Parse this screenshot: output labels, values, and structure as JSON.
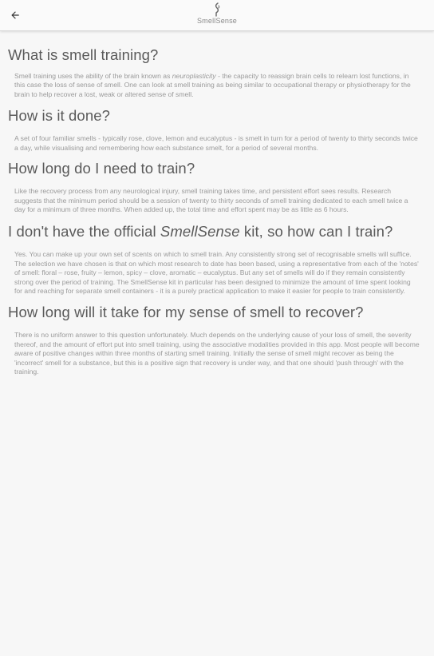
{
  "app": {
    "name": "SmellSense",
    "back_icon": "arrow-back-icon",
    "logo_icon": "smellsense-logo-icon",
    "colors": {
      "background": "#f7f7f7",
      "appbar": "#fafafa",
      "heading": "#5a5a5a",
      "body": "#9a9a9a"
    }
  },
  "sections": [
    {
      "title": "What is smell training?",
      "body_before": "Smell training uses the ability of the brain known as ",
      "body_em": "neuroplasticity",
      "body_after": " - the capacity to reassign brain cells to relearn lost functions, in this case the loss of sense of smell. One can look at smell training as being similar to occupational therapy or physiotherapy for the brain to help recover a lost, weak or altered sense of smell."
    },
    {
      "title": "How is it done?",
      "body": "A set of four familiar smells - typically rose, clove, lemon and eucalyptus - is smelt in turn for a period of twenty to thirty seconds twice a day, while visualising and remembering how each substance smelt, for a period of several months."
    },
    {
      "title": "How long do I need to train?",
      "body": "Like the recovery process from any neurological injury, smell training takes time, and persistent effort sees results. Research suggests that the minimum period should be a session of twenty to thirty seconds of smell training dedicated to each smell twice a day for a minimum of three months. When added up, the total time and effort spent may be as little as 6 hours."
    },
    {
      "title_before": "I don't have the official ",
      "title_em": "SmellSense",
      "title_after": " kit, so how can I train?",
      "body": "Yes. You can make up your own set of scents on which to smell train. Any consistently strong set of recognisable smells will suffice. The selection we have chosen is that on which most research to date has been based, using a representative from each of the 'notes' of smell: floral – rose, fruity – lemon, spicy – clove, aromatic – eucalyptus. But any set of smells will do if they remain consistently strong over the period of training. The SmellSense kit in particular has been designed to minimize the amount of time spent looking for and reaching for separate smell containers - it is a purely practical application to make it easier for people to train consistently."
    },
    {
      "title": "How long will it take for my sense of smell to recover?",
      "body": "There is no uniform answer to this question unfortunately. Much depends on the underlying cause of your loss of smell, the severity thereof, and the amount of effort put into smell training, using the associative modalities provided in this app. Most people will become aware of positive changes within three months of starting smell training. Initially the sense of smell might recover as being the 'incorrect' smell for a substance, but this is a positive sign that recovery is under way, and that one should 'push through' with the training."
    }
  ]
}
